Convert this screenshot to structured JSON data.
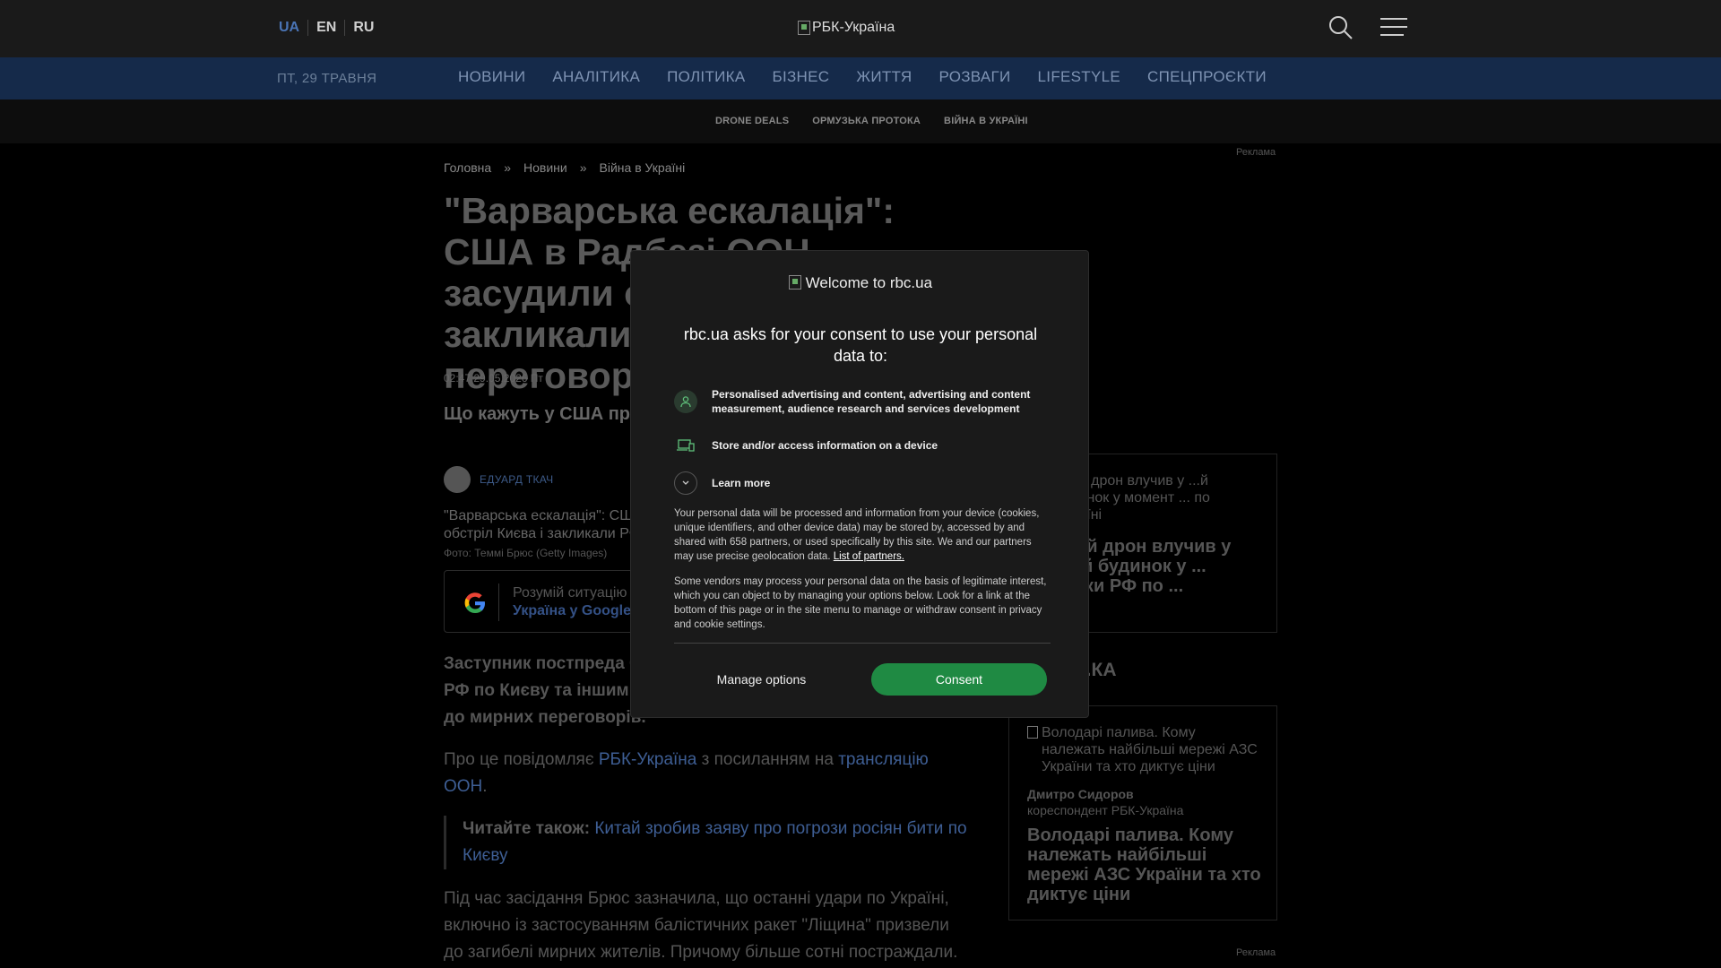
{
  "header": {
    "languages": [
      "UA",
      "EN",
      "RU"
    ],
    "active_language": "UA",
    "logo_alt": "РБК-Україна"
  },
  "nav": {
    "date": "ПТ, 29 ТРАВНЯ",
    "items": [
      "НОВИНИ",
      "АНАЛІТИКА",
      "ПОЛІТИКА",
      "БІЗНЕС",
      "ЖИТТЯ",
      "РОЗВАГИ",
      "LIFESTYLE",
      "СПЕЦПРОЄКТИ"
    ]
  },
  "subnav": {
    "items": [
      "DRONE DEALS",
      "ОРМУЗЬКА ПРОТОКА",
      "ВІЙНА В УКРАЇНІ"
    ]
  },
  "article": {
    "breadcrumb": [
      "Головна",
      "Новини",
      "Війна в Україні"
    ],
    "breadcrumb_sep": "»",
    "headline": "\"Варварська ескалація\": США в Радбезі ООН засудили обстріл Києва і закликали РФ до переговорів",
    "date": "02:47 29.05.2026 Пт",
    "subtitle": "Що кажуть у США про останні атаки Кремля?",
    "author": "ЕДУАРД ТКАЧ",
    "photo_alt": "\"Варварська ескалація\": США в Радбезі ООН засудили обстріл Києва і закликали РФ до переговорів",
    "photo_credit": "Фото: Теммі Брюс (Getty Images)",
    "google_line1": "Розумій ситуацію",
    "google_line2": "Україна у Google",
    "lead": "Заступник постпреда США при ООН засудила масовані атаки РФ по Києву та іншим містах і закликала Москву приєднатися до мирних переговорів.",
    "para1_prefix": "Про це повідомляє ",
    "para1_link1": "РБК-Україна",
    "para1_mid": " з посиланням на ",
    "para1_link2": "трансляцію ООН",
    "para1_suffix": ".",
    "read_also_label": "Читайте також:",
    "read_also_link": "Китай зробив заяву про погрози росіян бити по Києву",
    "para2": "Під час засідання Брюс зазначила, що останні удари по Україні, включно із застосуванням балістичних ракет \"Ліщина\" призвели до загибелі мирних жителів. Причому більше сотні постраждали."
  },
  "sidebar": {
    "ad_label": "Реклама",
    "card1_alt": "...ній дрон влучив у ...й будинок у момент ... по Україні",
    "card1_title": "...ній дрон влучив у ...ий будинок у ... атаки РФ по ...",
    "section_title": "...КА",
    "card2_alt": "Володарі палива. Кому належать найбільші мережі АЗС України та хто диктує ціни",
    "card2_author": "Дмитро Сидоров",
    "card2_role": "кореспондент РБК-Україна",
    "card2_title": "Володарі палива. Кому належать найбільші мережі АЗС України та хто диктує ціни"
  },
  "consent": {
    "logo_alt": "Welcome to rbc.ua",
    "title": "rbc.ua asks for your consent to use your personal data to:",
    "purpose1": "Personalised advertising and content, advertising and content measurement, audience research and services development",
    "purpose2": "Store and/or access information on a device",
    "learn_more": "Learn more",
    "body1": "Your personal data will be processed and information from your device (cookies, unique identifiers, and other device data) may be stored by, accessed by and shared with 658 partners, or used specifically by this site. We and our partners may use precise geolocation data. ",
    "partners_link": "List of partners.",
    "body2": "Some vendors may process your personal data on the basis of legitimate interest, which you can object to by managing your options below. Look for a link at the bottom of this page or in the site menu to manage or withdraw consent in privacy and cookie settings.",
    "manage_label": "Manage options",
    "consent_label": "Consent",
    "accent_color": "#1f8a43"
  }
}
